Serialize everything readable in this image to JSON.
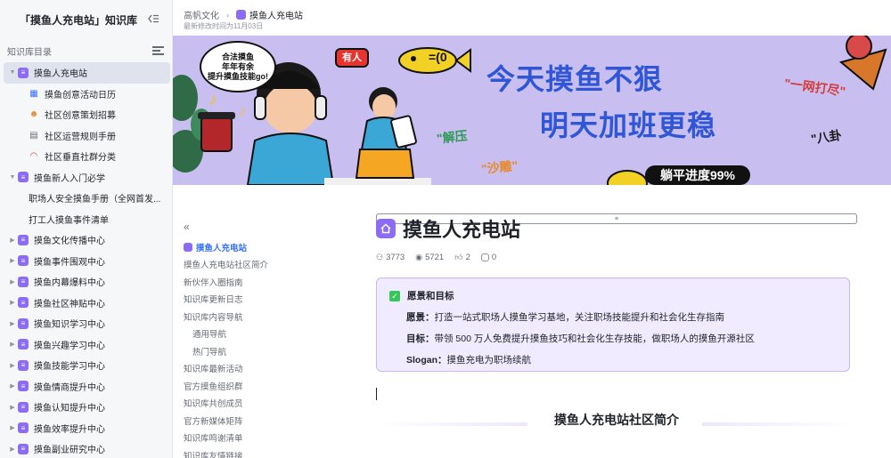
{
  "sidebar": {
    "title": "「摸鱼人充电站」知识库",
    "section_label": "知识库目录",
    "items": [
      {
        "label": "摸鱼人充电站",
        "level": 0,
        "caret": "▼",
        "icon": "purple-doc-icon"
      },
      {
        "label": "摸鱼创意活动日历",
        "level": 1,
        "caret": "",
        "icon": "calendar-icon"
      },
      {
        "label": "社区创意策划招募",
        "level": 1,
        "caret": "",
        "icon": "people-icon"
      },
      {
        "label": "社区运营规则手册",
        "level": 1,
        "caret": "",
        "icon": "book-icon"
      },
      {
        "label": "社区垂直社群分类",
        "level": 1,
        "caret": "",
        "icon": "rainbow-icon"
      },
      {
        "label": "摸鱼新人入门必学",
        "level": 0,
        "caret": "▼",
        "icon": "purple-doc-icon"
      },
      {
        "label": "职场人安全摸鱼手册（全网首发...",
        "level": 1,
        "caret": "",
        "icon": "doc-icon"
      },
      {
        "label": "打工人摸鱼事件清单",
        "level": 1,
        "caret": "",
        "icon": "doc-icon"
      },
      {
        "label": "摸鱼文化传播中心",
        "level": 0,
        "caret": "▶",
        "icon": "purple-doc-icon"
      },
      {
        "label": "摸鱼事件围观中心",
        "level": 0,
        "caret": "▶",
        "icon": "purple-doc-icon"
      },
      {
        "label": "摸鱼内幕爆料中心",
        "level": 0,
        "caret": "▶",
        "icon": "purple-doc-icon"
      },
      {
        "label": "摸鱼社区神贴中心",
        "level": 0,
        "caret": "▶",
        "icon": "purple-doc-icon"
      },
      {
        "label": "摸鱼知识学习中心",
        "level": 0,
        "caret": "▶",
        "icon": "purple-doc-icon"
      },
      {
        "label": "摸鱼兴趣学习中心",
        "level": 0,
        "caret": "▶",
        "icon": "purple-doc-icon"
      },
      {
        "label": "摸鱼技能学习中心",
        "level": 0,
        "caret": "▶",
        "icon": "purple-doc-icon"
      },
      {
        "label": "摸鱼情商提升中心",
        "level": 0,
        "caret": "▶",
        "icon": "purple-doc-icon"
      },
      {
        "label": "摸鱼认知提升中心",
        "level": 0,
        "caret": "▶",
        "icon": "purple-doc-icon"
      },
      {
        "label": "摸鱼效率提升中心",
        "level": 0,
        "caret": "▶",
        "icon": "purple-doc-icon"
      },
      {
        "label": "摸鱼副业研究中心",
        "level": 0,
        "caret": "▶",
        "icon": "purple-doc-icon"
      }
    ]
  },
  "topbar": {
    "crumb_root": "高帆文化",
    "crumb_current": "摸鱼人充电站",
    "modified": "最新修改时间为11月03日"
  },
  "banner": {
    "bubble": "合法摸鱼\n年年有余\n提升摸鱼技能go!",
    "badge": "有人",
    "headline1": "今天摸鱼不狠",
    "headline2": "明天加班更稳",
    "tag_jieya": "\"解压",
    "tag_shadiao": "\"沙雕\"",
    "tag_yiwang": "\"一网打尽\"",
    "tag_bagua": "\"八卦",
    "progress": "躺平进度99%",
    "fish_text": "=(0"
  },
  "outline": {
    "items": [
      {
        "label": "摸鱼人充电站",
        "active": true,
        "indent": false
      },
      {
        "label": "摸鱼人充电站社区简介",
        "active": false,
        "indent": false
      },
      {
        "label": "新伙伴入圈指南",
        "active": false,
        "indent": false
      },
      {
        "label": "知识库更新日志",
        "active": false,
        "indent": false
      },
      {
        "label": "知识库内容导航",
        "active": false,
        "indent": false
      },
      {
        "label": "通用导航",
        "active": false,
        "indent": true
      },
      {
        "label": "热门导航",
        "active": false,
        "indent": true
      },
      {
        "label": "知识库最新活动",
        "active": false,
        "indent": false
      },
      {
        "label": "官方摸鱼组织群",
        "active": false,
        "indent": false
      },
      {
        "label": "知识库共创成员",
        "active": false,
        "indent": false
      },
      {
        "label": "官方新媒体矩阵",
        "active": false,
        "indent": false
      },
      {
        "label": "知识库鸣谢清单",
        "active": false,
        "indent": false
      },
      {
        "label": "知识库友情链接",
        "active": false,
        "indent": false
      }
    ]
  },
  "doc": {
    "title": "摸鱼人充电站",
    "stats": {
      "members": "3773",
      "views": "5721",
      "likes": "2",
      "comments": "0"
    },
    "callout": {
      "heading": "愿景和目标",
      "vision_label": "愿景：",
      "vision": "打造一站式职场人摸鱼学习基地，关注职场技能提升和社会化生存指南",
      "goal_label": "目标：",
      "goal": "带领 500 万人免费提升摸鱼技巧和社会化生存技能，做职场人的摸鱼开源社区",
      "slogan_label": "Slogan：",
      "slogan": "摸鱼充电为职场续航"
    },
    "section_title": "摸鱼人充电站社区简介"
  },
  "colors": {
    "accent": "#8b6cf2",
    "link": "#3370ff",
    "banner_bg": "#c8bff0",
    "headline": "#2f56d6",
    "callout_bg": "#f1ebff"
  }
}
